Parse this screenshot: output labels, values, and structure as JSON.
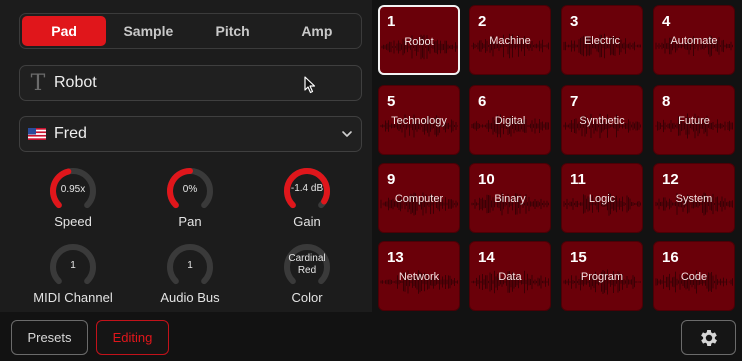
{
  "tabs": [
    {
      "label": "Pad",
      "active": true
    },
    {
      "label": "Sample",
      "active": false
    },
    {
      "label": "Pitch",
      "active": false
    },
    {
      "label": "Amp",
      "active": false
    }
  ],
  "name_field": {
    "icon": "text-icon",
    "value": "Robot"
  },
  "voice_select": {
    "flag": "us-flag-icon",
    "value": "Fred"
  },
  "knobs": [
    {
      "label": "Speed",
      "value": "0.95x",
      "level": 0.45
    },
    {
      "label": "Pan",
      "value": "0%",
      "level": 0.5
    },
    {
      "label": "Gain",
      "value": "-1.4 dB",
      "level": 0.95
    },
    {
      "label": "MIDI Channel",
      "value": "1",
      "level": 0
    },
    {
      "label": "Audio Bus",
      "value": "1",
      "level": 0
    },
    {
      "label": "Color",
      "value": "Cardinal Red",
      "level": 0
    }
  ],
  "pads": [
    {
      "number": "1",
      "name": "Robot",
      "selected": true
    },
    {
      "number": "2",
      "name": "Machine",
      "selected": false
    },
    {
      "number": "3",
      "name": "Electric",
      "selected": false
    },
    {
      "number": "4",
      "name": "Automate",
      "selected": false
    },
    {
      "number": "5",
      "name": "Technology",
      "selected": false
    },
    {
      "number": "6",
      "name": "Digital",
      "selected": false
    },
    {
      "number": "7",
      "name": "Synthetic",
      "selected": false
    },
    {
      "number": "8",
      "name": "Future",
      "selected": false
    },
    {
      "number": "9",
      "name": "Computer",
      "selected": false
    },
    {
      "number": "10",
      "name": "Binary",
      "selected": false
    },
    {
      "number": "11",
      "name": "Logic",
      "selected": false
    },
    {
      "number": "12",
      "name": "System",
      "selected": false
    },
    {
      "number": "13",
      "name": "Network",
      "selected": false
    },
    {
      "number": "14",
      "name": "Data",
      "selected": false
    },
    {
      "number": "15",
      "name": "Program",
      "selected": false
    },
    {
      "number": "16",
      "name": "Code",
      "selected": false
    }
  ],
  "footer": {
    "presets_label": "Presets",
    "editing_label": "Editing",
    "settings_icon": "gear-icon"
  },
  "colors": {
    "accent": "#e0161b",
    "pad_fill": "#6a0009",
    "knob_track": "#3a3a3a",
    "background": "#121212"
  }
}
